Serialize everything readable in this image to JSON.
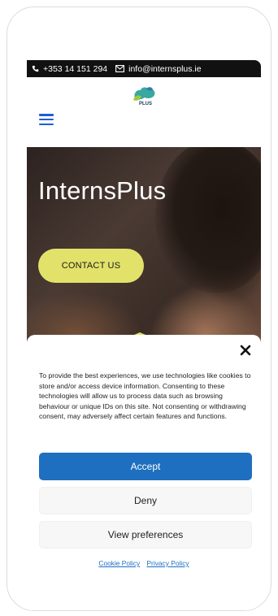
{
  "topbar": {
    "phone": "+353 14 151 294",
    "email": "info@internsplus.ie"
  },
  "header": {
    "logo_text": "PLUS",
    "menu_icon": "hamburger-icon"
  },
  "hero": {
    "title": "InternsPlus",
    "contact_label": "CONTACT US"
  },
  "cookie": {
    "message": "To provide the best experiences, we use technologies like cookies to store and/or access device information. Consenting to these technologies will allow us to process data such as browsing behaviour or unique IDs on this site. Not consenting or withdrawing consent, may adversely affect certain features and functions.",
    "accept_label": "Accept",
    "deny_label": "Deny",
    "preferences_label": "View preferences",
    "cookie_policy": "Cookie Policy",
    "privacy_policy": "Privacy Policy"
  },
  "colors": {
    "accent_blue": "#1e6fbf",
    "menu_blue": "#1d5fd0",
    "contact_yellow": "#e2e26a",
    "topbar": "#111111"
  }
}
